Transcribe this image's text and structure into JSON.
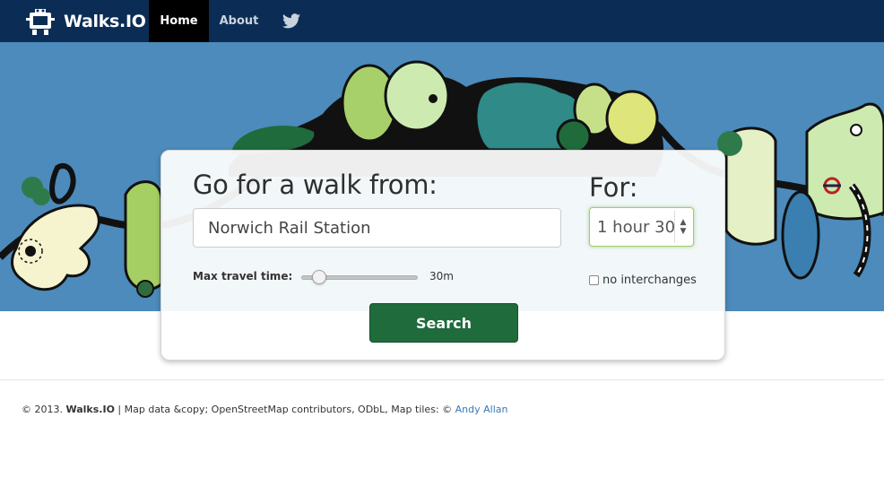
{
  "nav": {
    "brand": "Walks.IO",
    "home": "Home",
    "about": "About",
    "twitter_icon": "twitter-bird-icon"
  },
  "panel": {
    "title": "Go for a walk from:",
    "from_value": "Norwich Rail Station",
    "for_label": "For:",
    "duration_value": "1 hour 30",
    "slider_label": "Max travel time:",
    "slider_value": "30m",
    "slider_fraction": 0.15,
    "no_interchanges_label": "no interchanges",
    "no_interchanges_checked": false,
    "search_label": "Search"
  },
  "footer": {
    "copyright": "© 2013.",
    "site": "Walks.IO",
    "mapdata": "| Map data &copy; OpenStreetMap contributors, ODbL, Map tiles: ©",
    "tiles_author": "Andy Allan"
  },
  "colors": {
    "navbar": "#0b2d55",
    "hero_sky": "#4c8bbb",
    "search_button": "#1f6b3c",
    "link": "#3a78b5"
  }
}
